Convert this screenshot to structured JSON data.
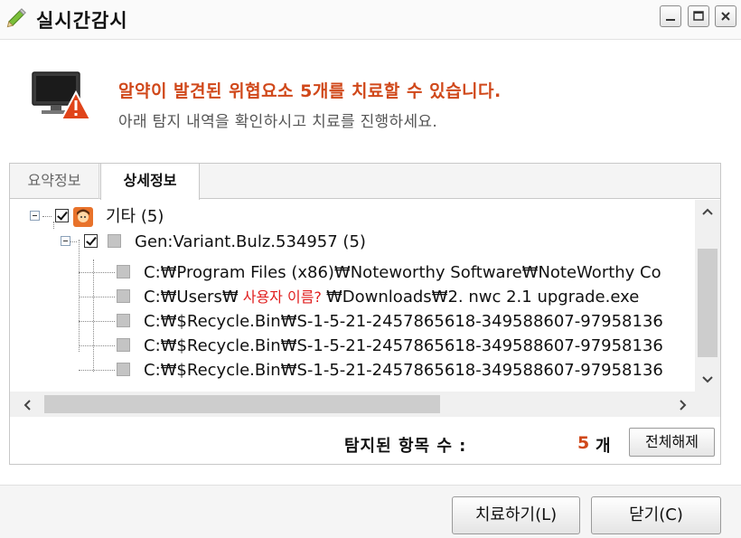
{
  "window": {
    "title": "실시간감시",
    "icon": "pencil-icon",
    "controls": [
      "minimize-icon",
      "maximize-icon",
      "close-icon"
    ]
  },
  "alert": {
    "icon": "monitor-warning-icon",
    "title": "알약이 발견된 위협요소 5개를 치료할 수 있습니다.",
    "subtitle": "아래 탐지 내역을 확인하시고 치료를 진행하세요."
  },
  "tabs": [
    {
      "label": "요약정보",
      "active": false
    },
    {
      "label": "상세정보",
      "active": true
    }
  ],
  "tree": {
    "root": {
      "label": "기타 (5)",
      "checked": true,
      "icon": "user-icon"
    },
    "child": {
      "label": "Gen:Variant.Bulz.534957 (5)",
      "checked": true
    },
    "files": [
      {
        "path": "C:₩Program Files (x86)₩Noteworthy Software₩NoteWorthy Co"
      },
      {
        "prefix": "C:₩Users₩",
        "username": " 사용자 이름? ",
        "suffix": "₩Downloads₩2. nwc 2.1 upgrade.exe"
      },
      {
        "path": "C:₩$Recycle.Bin₩S-1-5-21-2457865618-349588607-97958136"
      },
      {
        "path": "C:₩$Recycle.Bin₩S-1-5-21-2457865618-349588607-97958136"
      },
      {
        "path": "C:₩$Recycle.Bin₩S-1-5-21-2457865618-349588607-97958136"
      }
    ]
  },
  "summary": {
    "label": "탐지된 항목 수 :",
    "count": "5",
    "unit": "개",
    "release_all": "전체해제"
  },
  "footer": {
    "treat_button": "치료하기(L)",
    "close_button": "닫기(C)"
  },
  "colors": {
    "accent": "#d0481a",
    "warning": "#e02020"
  }
}
